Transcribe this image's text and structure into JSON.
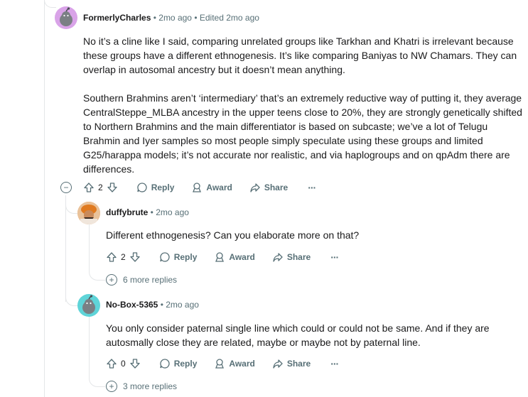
{
  "comments": [
    {
      "username": "FormerlyCharles",
      "sep1": "•",
      "time": "2mo ago",
      "sep2": "•",
      "edited": "Edited 2mo ago",
      "paragraphs": [
        "No it’s a cline like I said, comparing unrelated groups like Tarkhan and Khatri is irrelevant because these groups have a different ethnogenesis. It’s like comparing Baniyas to NW Chamars. They can overlap in autosomal ancestry but it doesn’t mean anything.",
        "Southern Brahmins aren’t ‘intermediary’ that’s an extremely reductive way of putting it, they average CentralSteppe_MLBA ancestry in the upper teens close to 20%, they are strongly genetically shifted to Northern Brahmins and the main differentiator is based on subcaste; we’ve a lot of Telugu Brahmin and Iyer samples so most people simply speculate using these groups and limited G25/harappa models; it’s not accurate nor realistic, and via haplogroups and on qpAdm there are differences."
      ],
      "votes": "2",
      "reply": "Reply",
      "award": "Award",
      "share": "Share",
      "more": "···",
      "collapse": "−"
    },
    {
      "username": "duffybrute",
      "sep1": "•",
      "time": "2mo ago",
      "text": "Different ethnogenesis? Can you elaborate more on that?",
      "votes": "2",
      "reply": "Reply",
      "award": "Award",
      "share": "Share",
      "more": "···",
      "more_replies": "6 more replies",
      "plus": "+"
    },
    {
      "username": "No-Box-5365",
      "sep1": "•",
      "time": "2mo ago",
      "text": "You only consider paternal single line which could or could not be same. And if they are autosmally close they are related, maybe or maybe not by paternal line.",
      "votes": "0",
      "reply": "Reply",
      "award": "Award",
      "share": "Share",
      "more": "···",
      "more_replies": "3 more replies",
      "plus": "+"
    }
  ],
  "colors": {
    "avatar1_bg": "#d9a3e8",
    "avatar3_bg": "#5fd4d8",
    "meta": "#576f76",
    "thread_line": "#e4e6e8"
  }
}
